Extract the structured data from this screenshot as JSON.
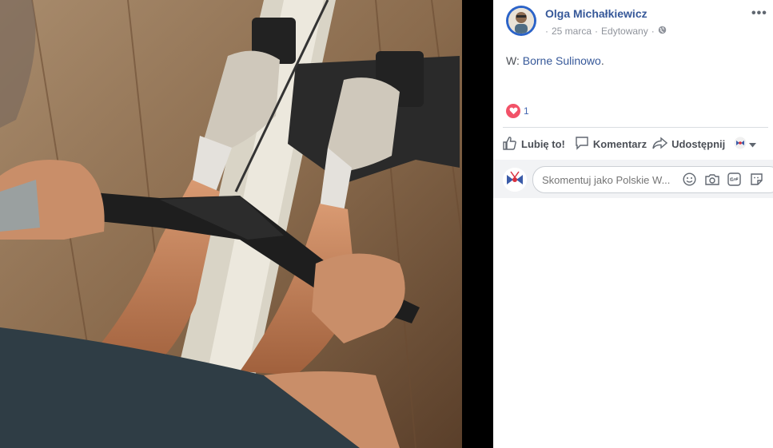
{
  "post": {
    "author": "Olga Michałkiewicz",
    "date": "25 marca",
    "edited": "Edytowany",
    "privacy_icon": "globe-icon",
    "location_prefix": "W:",
    "location_name": "Borne Sulinowo",
    "location_suffix": "."
  },
  "reactions": {
    "type": "love",
    "count": "1"
  },
  "actions": {
    "like": "Lubię to!",
    "comment": "Komentarz",
    "share": "Udostępnij"
  },
  "comment": {
    "placeholder": "Skomentuj jako Polskie W..."
  },
  "colors": {
    "link": "#365899",
    "heart": "#f25268",
    "avatar_ring": "#2b63c8"
  }
}
